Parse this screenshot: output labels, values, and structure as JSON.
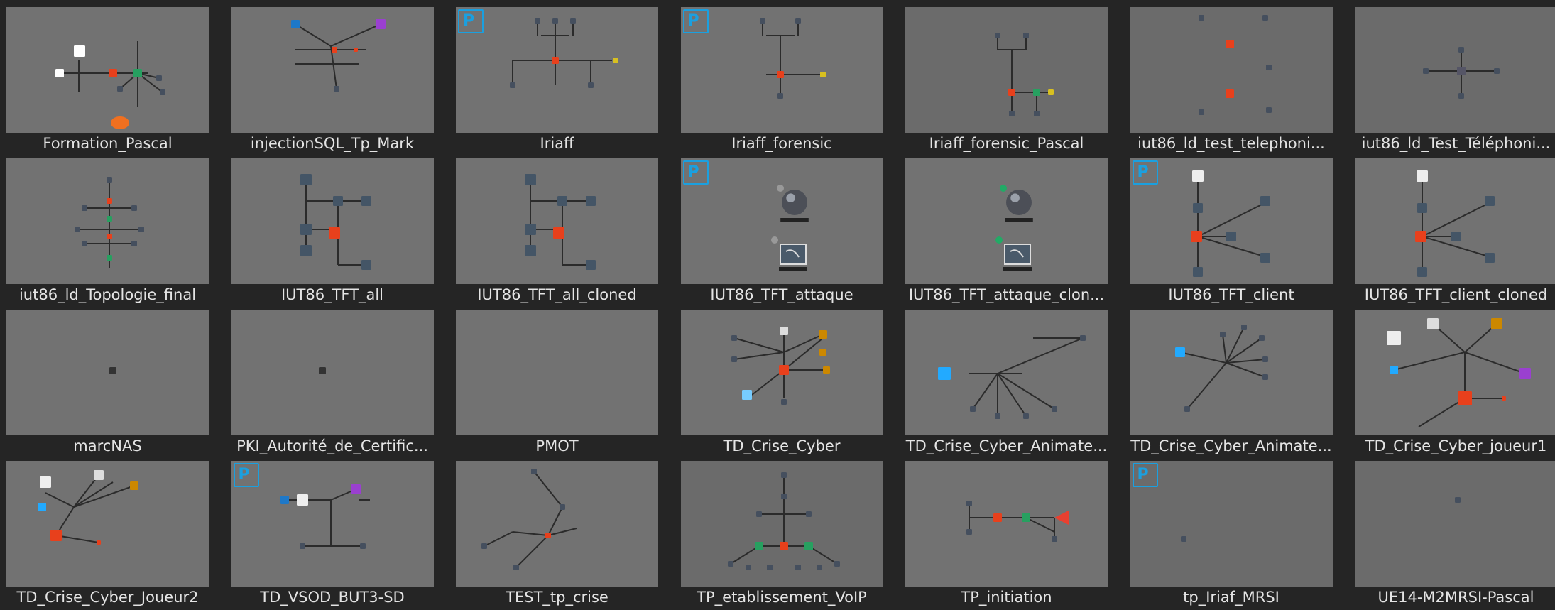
{
  "projects": [
    {
      "name": "Formation_Pascal",
      "badge": ""
    },
    {
      "name": "injectionSQL_Tp_Mark",
      "badge": ""
    },
    {
      "name": "Iriaff",
      "badge": "P"
    },
    {
      "name": "Iriaff_forensic",
      "badge": "P"
    },
    {
      "name": "Iriaff_forensic_Pascal",
      "badge": ""
    },
    {
      "name": "iut86_ld_test_telephoni...",
      "badge": ""
    },
    {
      "name": "iut86_ld_Test_Téléphoni...",
      "badge": ""
    },
    {
      "name": "iut86_ld_Topologie_final",
      "badge": ""
    },
    {
      "name": "IUT86_TFT_all",
      "badge": ""
    },
    {
      "name": "IUT86_TFT_all_cloned",
      "badge": ""
    },
    {
      "name": "IUT86_TFT_attaque",
      "badge": "P"
    },
    {
      "name": "IUT86_TFT_attaque_clon...",
      "badge": ""
    },
    {
      "name": "IUT86_TFT_client",
      "badge": "P"
    },
    {
      "name": "IUT86_TFT_client_cloned",
      "badge": ""
    },
    {
      "name": "marcNAS",
      "badge": ""
    },
    {
      "name": "PKI_Autorité_de_Certific...",
      "badge": ""
    },
    {
      "name": "PMOT",
      "badge": ""
    },
    {
      "name": "TD_Crise_Cyber",
      "badge": ""
    },
    {
      "name": "TD_Crise_Cyber_Animate...",
      "badge": ""
    },
    {
      "name": "TD_Crise_Cyber_Animate...",
      "badge": ""
    },
    {
      "name": "TD_Crise_Cyber_joueur1",
      "badge": ""
    },
    {
      "name": "TD_Crise_Cyber_Joueur2",
      "badge": ""
    },
    {
      "name": "TD_VSOD_BUT3-SD",
      "badge": "P"
    },
    {
      "name": "TEST_tp_crise",
      "badge": ""
    },
    {
      "name": "TP_etablissement_VoIP",
      "badge": ""
    },
    {
      "name": "TP_initiation",
      "badge": ""
    },
    {
      "name": "tp_Iriaf_MRSI",
      "badge": "P"
    },
    {
      "name": "UE14-M2MRSI-Pascal",
      "badge": ""
    }
  ]
}
